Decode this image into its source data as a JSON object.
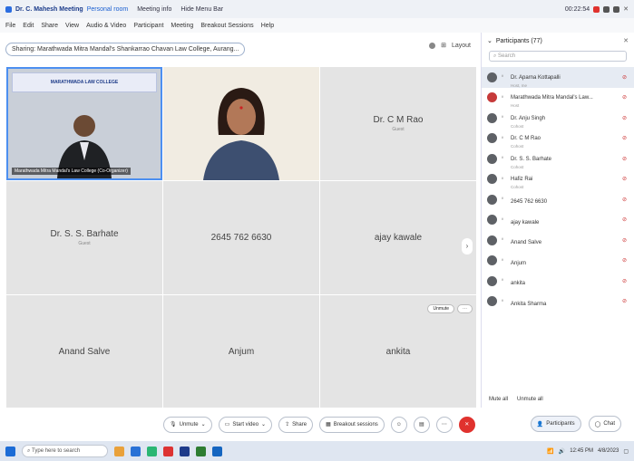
{
  "titlebar": {
    "title": "Dr. C. Mahesh Meeting",
    "link": "Personal room",
    "item2": "Meeting info",
    "item3": "Hide Menu Bar",
    "timer": "00:22:54"
  },
  "menubar": [
    "File",
    "Edit",
    "Share",
    "View",
    "Audio & Video",
    "Participant",
    "Meeting",
    "Breakout Sessions",
    "Help"
  ],
  "toolbar": {
    "sharing": "Sharing: Marathwada Mitra Mandal's Shankarrao Chavan Law College, Aurang...",
    "layout": "Layout"
  },
  "tiles": [
    {
      "name": "",
      "role": "",
      "video": "video1",
      "banner": "MARATHWADA LAW COLLEGE",
      "label": "Marathwada Mitra Mandal's Law College (Co-Organizer)"
    },
    {
      "name": "",
      "role": "",
      "video": "video2"
    },
    {
      "name": "Dr. C M Rao",
      "role": "Guest"
    },
    {
      "name": "Dr. S. S. Barhate",
      "role": "Guest"
    },
    {
      "name": "2645 762 6630",
      "role": ""
    },
    {
      "name": "ajay kawale",
      "role": ""
    },
    {
      "name": "Anand Salve",
      "role": ""
    },
    {
      "name": "Anjum",
      "role": ""
    },
    {
      "name": "ankita",
      "role": "",
      "unmute": "Unmute"
    }
  ],
  "panel": {
    "title": "Participants (77)",
    "search_placeholder": "Search",
    "participants": [
      {
        "name": "Dr. Aparna Kottapalli",
        "role": "Host, me"
      },
      {
        "name": "Marathwada Mitra Mandal's Law...",
        "role": "Host"
      },
      {
        "name": "Dr. Anju Singh",
        "role": "Cohost"
      },
      {
        "name": "Dr. C M Rao",
        "role": "Cohost"
      },
      {
        "name": "Dr. S. S. Barhate",
        "role": "Cohost"
      },
      {
        "name": "Hafiz Rai",
        "role": "Cohost"
      },
      {
        "name": "2645 762 6630",
        "role": ""
      },
      {
        "name": "ajay kawale",
        "role": ""
      },
      {
        "name": "Anand Salve",
        "role": ""
      },
      {
        "name": "Anjum",
        "role": ""
      },
      {
        "name": "ankita",
        "role": ""
      },
      {
        "name": "Ankita Sharma",
        "role": ""
      }
    ],
    "mute_all": "Mute all",
    "unmute_all": "Unmute all"
  },
  "controls": {
    "unmute": "Unmute",
    "start_video": "Start video",
    "share": "Share",
    "breakout": "Breakout sessions",
    "participants": "Participants",
    "chat": "Chat"
  },
  "taskbar": {
    "search": "Type here to search",
    "time": "12:45 PM",
    "date": "4/8/2023"
  },
  "colors": {
    "accent": "#4c8ff0",
    "leave": "#e0322e"
  }
}
